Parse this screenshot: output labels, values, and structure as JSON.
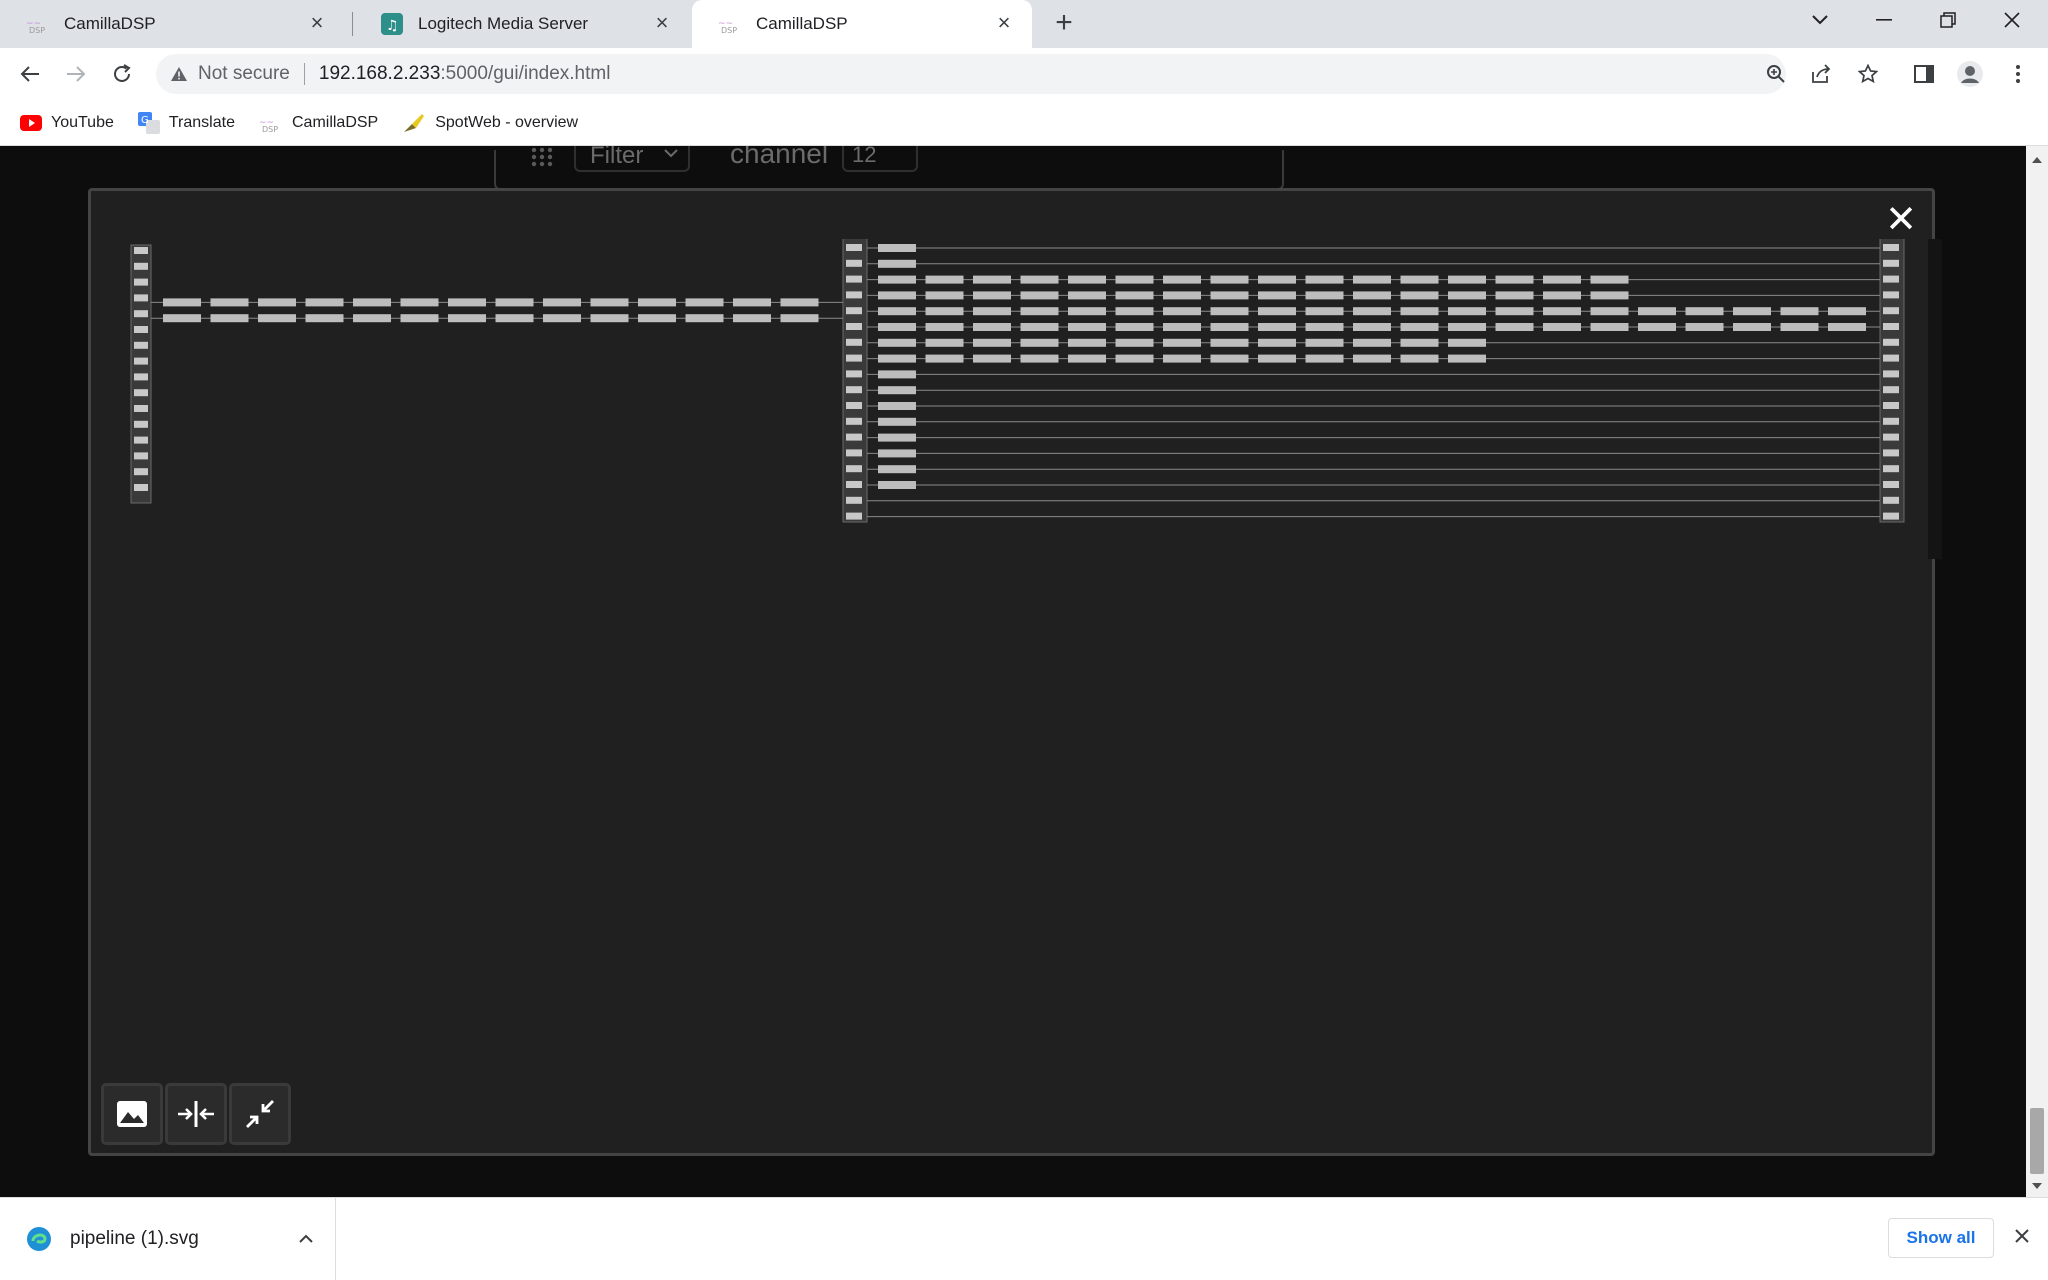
{
  "browser": {
    "tabs": [
      {
        "title": "CamillaDSP",
        "favicon": "camilladsp-icon",
        "active": false
      },
      {
        "title": "Logitech Media Server",
        "favicon": "lms-icon",
        "active": false
      },
      {
        "title": "CamillaDSP",
        "favicon": "camilladsp-icon",
        "active": true
      }
    ],
    "tab_close_glyph": "×",
    "new_tab_glyph": "+",
    "address": {
      "security_label": "Not secure",
      "host": "192.168.2.233",
      "path": ":5000/gui/index.html"
    },
    "bookmarks": [
      {
        "label": "YouTube",
        "icon": "youtube-icon"
      },
      {
        "label": "Translate",
        "icon": "translate-icon"
      },
      {
        "label": "CamillaDSP",
        "icon": "camilladsp-icon"
      },
      {
        "label": "SpotWeb - overview",
        "icon": "spotweb-icon"
      }
    ]
  },
  "page": {
    "background_panel": {
      "filter_label": "Filter",
      "channel_label": "channel",
      "channel_value": "12"
    },
    "modal": {
      "close_glyph": "✕",
      "toolbar": [
        {
          "name": "image-button",
          "icon": "image-icon"
        },
        {
          "name": "fit-width-button",
          "icon": "fit-width-icon"
        },
        {
          "name": "exit-fullscreen-button",
          "icon": "exit-fullscreen-icon"
        }
      ]
    }
  },
  "downloads": {
    "file_name": "pipeline (1).svg",
    "show_all_label": "Show all"
  },
  "colors": {
    "tabstrip": "#dee1e6",
    "modal_bg": "#202020",
    "page_bg": "#0d0d0d",
    "link_blue": "#1a73e8"
  }
}
